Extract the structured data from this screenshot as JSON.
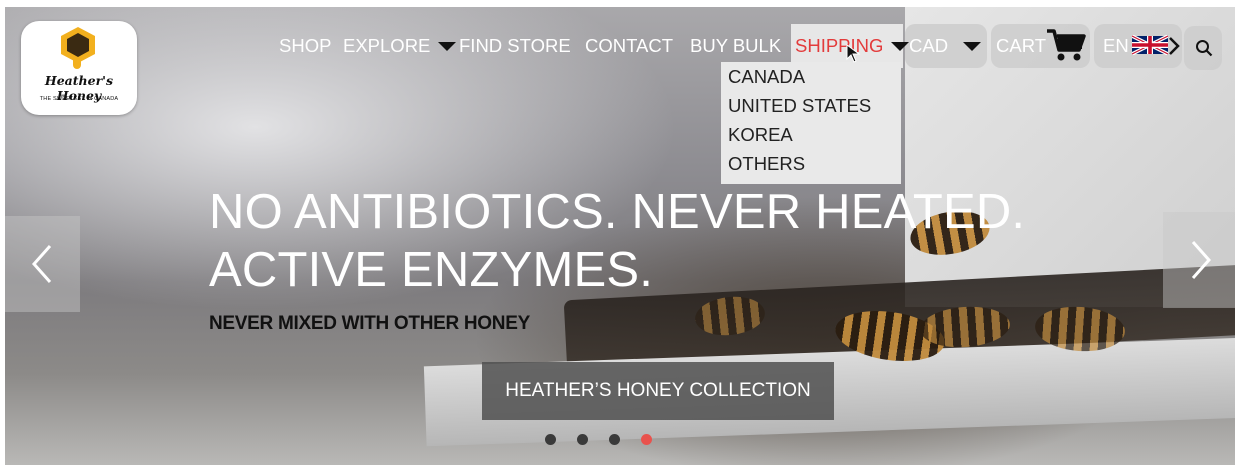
{
  "brand": {
    "name": "Heather's Honey",
    "tagline": "THE SWEETEST IN CANADA"
  },
  "nav": {
    "shop": "SHOP",
    "explore": "EXPLORE",
    "find_store": "FIND STORE",
    "contact": "CONTACT",
    "buy_bulk": "BUY BULK",
    "shipping": "SHIPPING",
    "currency": "CAD",
    "cart": "CART",
    "language": "EN"
  },
  "shipping_menu": {
    "options": [
      "CANADA",
      "UNITED STATES",
      "KOREA",
      "OTHERS"
    ]
  },
  "hero": {
    "title_line1": "NO ANTIBIOTICS. NEVER HEATED.",
    "title_line2": "ACTIVE ENZYMES.",
    "subtitle": "NEVER MIXED WITH OTHER HONEY",
    "cta": "HEATHER’S HONEY COLLECTION"
  },
  "carousel": {
    "slide_count": 4,
    "active_index": 3
  },
  "colors": {
    "accent_red": "#e33b3b",
    "active_dot": "#e9524d",
    "honey_gold": "#f2b01e"
  },
  "icons": {
    "explore_caret": "caret-down-icon",
    "shipping_caret": "caret-down-icon",
    "currency_caret": "caret-down-icon",
    "cart": "cart-icon",
    "language_flag": "uk-flag-icon",
    "language_next": "chevron-right-icon",
    "search": "search-icon",
    "carousel_prev": "chevron-left-icon",
    "carousel_next": "chevron-right-icon",
    "logo_mark": "honeycomb-bee-icon",
    "cursor": "mouse-pointer-icon"
  }
}
